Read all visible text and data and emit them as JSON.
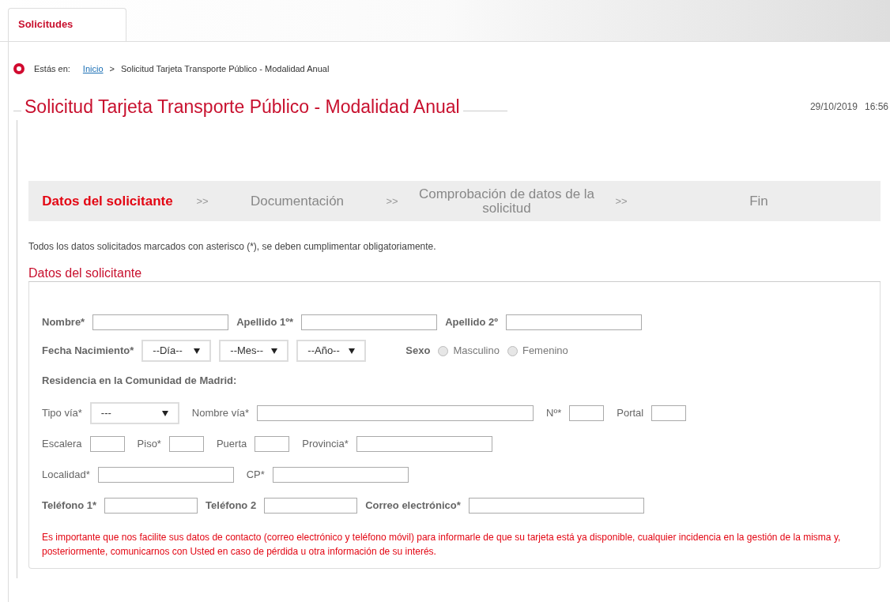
{
  "tabs": [
    {
      "label": "Solicitudes",
      "selected": true
    }
  ],
  "breadcrumb": {
    "prefix": "Estás en:",
    "items": [
      {
        "label": "Inicio",
        "kind": "link"
      },
      {
        "label": "Solicitud Tarjeta Transporte Público - Modalidad Anual",
        "kind": "current"
      }
    ],
    "separator": ">"
  },
  "page_title": "Solicitud Tarjeta Transporte Público - Modalidad Anual",
  "date": "29/10/2019",
  "time": "16:56",
  "steps": [
    {
      "label": "Datos del solicitante",
      "selected": true
    },
    {
      "label": ">>",
      "kind": "separator"
    },
    {
      "label": "Documentación",
      "selected": false
    },
    {
      "label": ">>",
      "kind": "separator"
    },
    {
      "label": "Comprobación de datos de la solicitud",
      "selected": false
    },
    {
      "label": ">>",
      "kind": "separator"
    },
    {
      "label": "Fin",
      "selected": false
    }
  ],
  "required_note": "Todos los datos solicitados marcados con asterisco (*), se deben cumplimentar obligatoriamente.",
  "section_title": "Datos del solicitante",
  "form_rows": [
    {
      "items": [
        {
          "kind": "strong_label",
          "text": "Nombre*"
        },
        {
          "kind": "input"
        },
        {
          "kind": "strong_label",
          "text": "Apellido 1º*"
        },
        {
          "kind": "input"
        },
        {
          "kind": "strong_label",
          "text": "Apellido 2º"
        },
        {
          "kind": "input"
        }
      ]
    },
    {
      "items": [
        {
          "kind": "strong_label",
          "text": "Fecha Nacimiento*"
        },
        {
          "kind": "select",
          "value": "--Día--"
        },
        {
          "kind": "select",
          "value": "--Mes--"
        },
        {
          "kind": "select",
          "value": "--Año--"
        },
        {
          "kind": "strong_label",
          "text": "Sexo"
        },
        {
          "kind": "radio",
          "text": "Masculino",
          "selected": false
        },
        {
          "kind": "radio",
          "text": "Femenino",
          "selected": false
        }
      ]
    },
    {
      "items": [
        {
          "kind": "heading",
          "text": "Residencia en la Comunidad de Madrid:"
        }
      ]
    },
    {
      "items": [
        {
          "kind": "label",
          "text": "Tipo vía*"
        },
        {
          "kind": "select",
          "value": "---"
        },
        {
          "kind": "label",
          "text": "Nombre vía*"
        },
        {
          "kind": "input"
        },
        {
          "kind": "label",
          "text": "Nº*"
        },
        {
          "kind": "input"
        },
        {
          "kind": "label",
          "text": "Portal"
        },
        {
          "kind": "input"
        }
      ]
    },
    {
      "items": [
        {
          "kind": "label",
          "text": "Escalera"
        },
        {
          "kind": "input"
        },
        {
          "kind": "label",
          "text": "Piso*"
        },
        {
          "kind": "input"
        },
        {
          "kind": "label",
          "text": "Puerta"
        },
        {
          "kind": "input"
        },
        {
          "kind": "label",
          "text": "Provincia*"
        },
        {
          "kind": "input"
        }
      ]
    },
    {
      "items": [
        {
          "kind": "label",
          "text": "Localidad*"
        },
        {
          "kind": "input"
        },
        {
          "kind": "label",
          "text": "CP*"
        },
        {
          "kind": "input"
        }
      ]
    },
    {
      "items": [
        {
          "kind": "strong_label",
          "text": "Teléfono 1*"
        },
        {
          "kind": "input"
        },
        {
          "kind": "strong_label",
          "text": "Teléfono 2"
        },
        {
          "kind": "input"
        },
        {
          "kind": "strong_label",
          "text": "Correo electrónico*"
        },
        {
          "kind": "input"
        }
      ]
    }
  ],
  "contact_note": "Es importante que nos facilite sus datos de contacto (correo electrónico y teléfono móvil) para informarle de que su tarjeta está ya disponible, cualquier incidencia en la gestión de la misma y, posteriormente, comunicarnos con Usted en caso de pérdida u otra información de su interés."
}
